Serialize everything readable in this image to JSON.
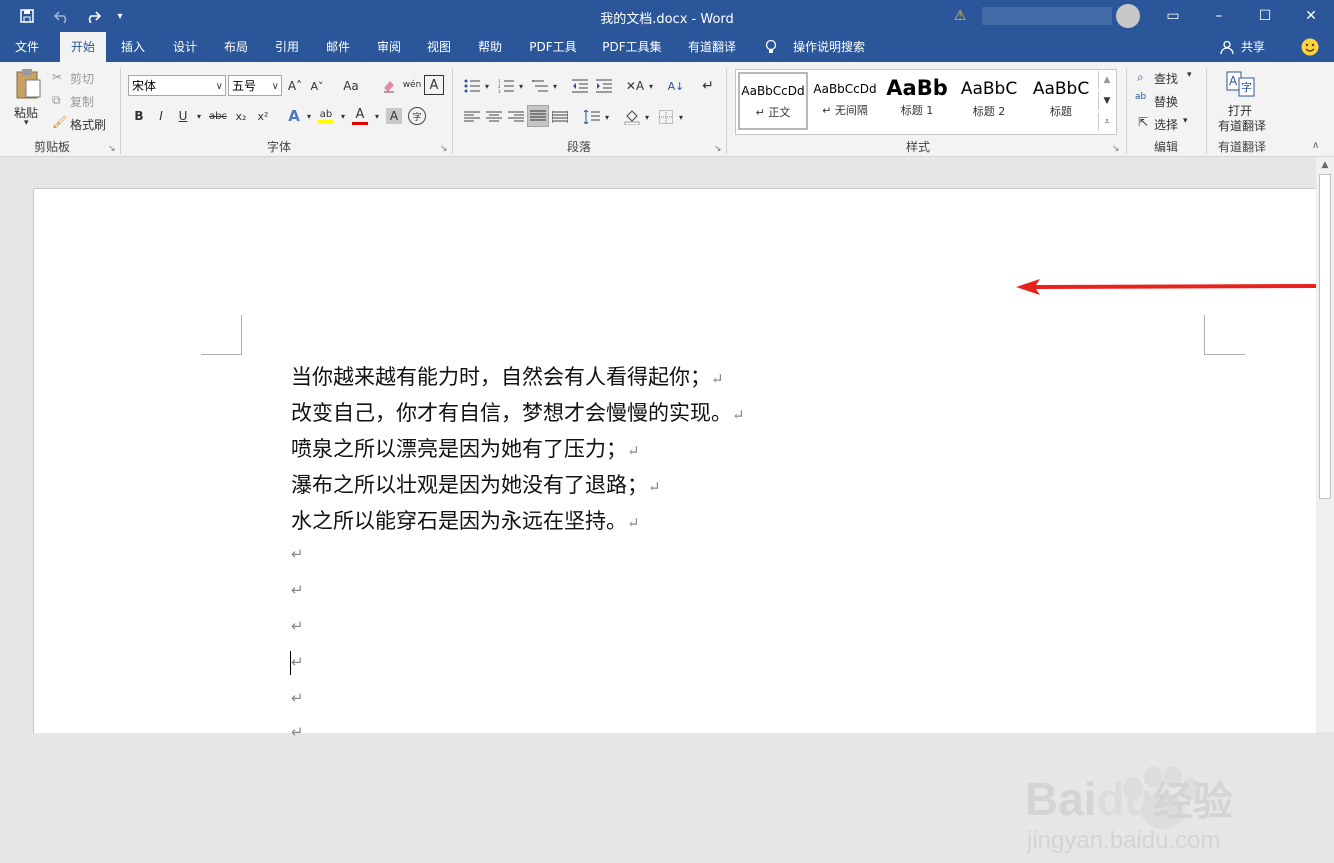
{
  "titlebar": {
    "title": "我的文档.docx  -  Word",
    "qat": {
      "save_icon": "save-icon",
      "undo_icon": "undo-icon",
      "redo_icon": "redo-icon",
      "customize_icon": "chevron-down-icon"
    },
    "window": {
      "min": "–",
      "max": "☐",
      "close": "✕",
      "ribbon_display": "▭"
    },
    "warning": "⚠"
  },
  "tabs": {
    "file": "文件",
    "home": "开始",
    "insert": "插入",
    "design": "设计",
    "layout": "布局",
    "references": "引用",
    "mailings": "邮件",
    "review": "审阅",
    "view": "视图",
    "help": "帮助",
    "pdf_tools": "PDF工具",
    "pdf_tools_set": "PDF工具集",
    "youdao": "有道翻译",
    "tell_me": "操作说明搜索",
    "share": "共享"
  },
  "clipboard": {
    "paste": "粘贴",
    "cut": "剪切",
    "copy": "复制",
    "format_painter": "格式刷",
    "label": "剪贴板"
  },
  "font": {
    "name": "宋体",
    "size": "五号",
    "label": "字体",
    "bold": "B",
    "italic": "I",
    "underline": "U",
    "strike": "abc",
    "sub": "x₂",
    "sup": "x²",
    "grow": "A˄",
    "shrink": "A˅",
    "case": "Aa",
    "wen": "wén",
    "char_border": "A",
    "char_shade": "A",
    "enclose": "字"
  },
  "paragraph": {
    "label": "段落"
  },
  "styles": {
    "label": "样式",
    "items": [
      {
        "preview": "AaBbCcDd",
        "name": "↵ 正文"
      },
      {
        "preview": "AaBbCcDd",
        "name": "↵ 无间隔"
      },
      {
        "preview": "AaBb",
        "name": "标题 1"
      },
      {
        "preview": "AaBbC",
        "name": "标题 2"
      },
      {
        "preview": "AaBbC",
        "name": "标题"
      }
    ]
  },
  "editing": {
    "find": "查找",
    "replace": "替换",
    "select": "选择",
    "label": "编辑"
  },
  "youdao_group": {
    "open_line1": "打开",
    "open_line2": "有道翻译",
    "label": "有道翻译"
  },
  "document": {
    "lines": [
      "当你越来越有能力时，自然会有人看得起你；",
      "改变自己，你才有自信，梦想才会慢慢的实现。",
      "喷泉之所以漂亮是因为她有了压力；",
      "瀑布之所以壮观是因为她没有了退路；",
      "水之所以能穿石是因为永远在坚持。"
    ],
    "return_mark": "↵"
  },
  "watermark": {
    "brand": "Bai",
    "brand2": "du",
    "cn": "经验",
    "url": "jingyan.baidu.com"
  },
  "colors": {
    "accent": "#2b579a",
    "arrow": "#e8231d",
    "font_color_bar": "#e00000",
    "highlight_bar": "#ffff00"
  }
}
